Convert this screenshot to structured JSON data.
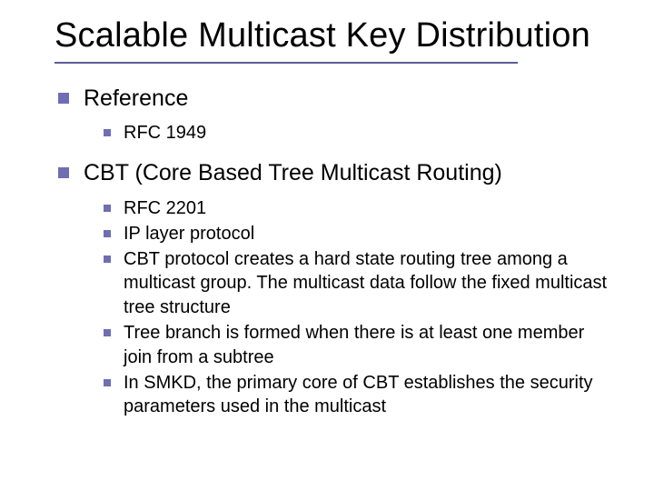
{
  "title": "Scalable Multicast Key Distribution",
  "sections": [
    {
      "heading": "Reference",
      "items": [
        "RFC 1949"
      ]
    },
    {
      "heading": "CBT (Core Based Tree Multicast Routing)",
      "items": [
        "RFC 2201",
        "IP layer protocol",
        "CBT protocol creates a hard state routing tree among a multicast group. The multicast data follow the fixed multicast tree structure",
        "Tree branch is formed when there is at least one member join from a subtree",
        "In SMKD, the primary core of CBT establishes the security parameters used in the multicast"
      ]
    }
  ]
}
